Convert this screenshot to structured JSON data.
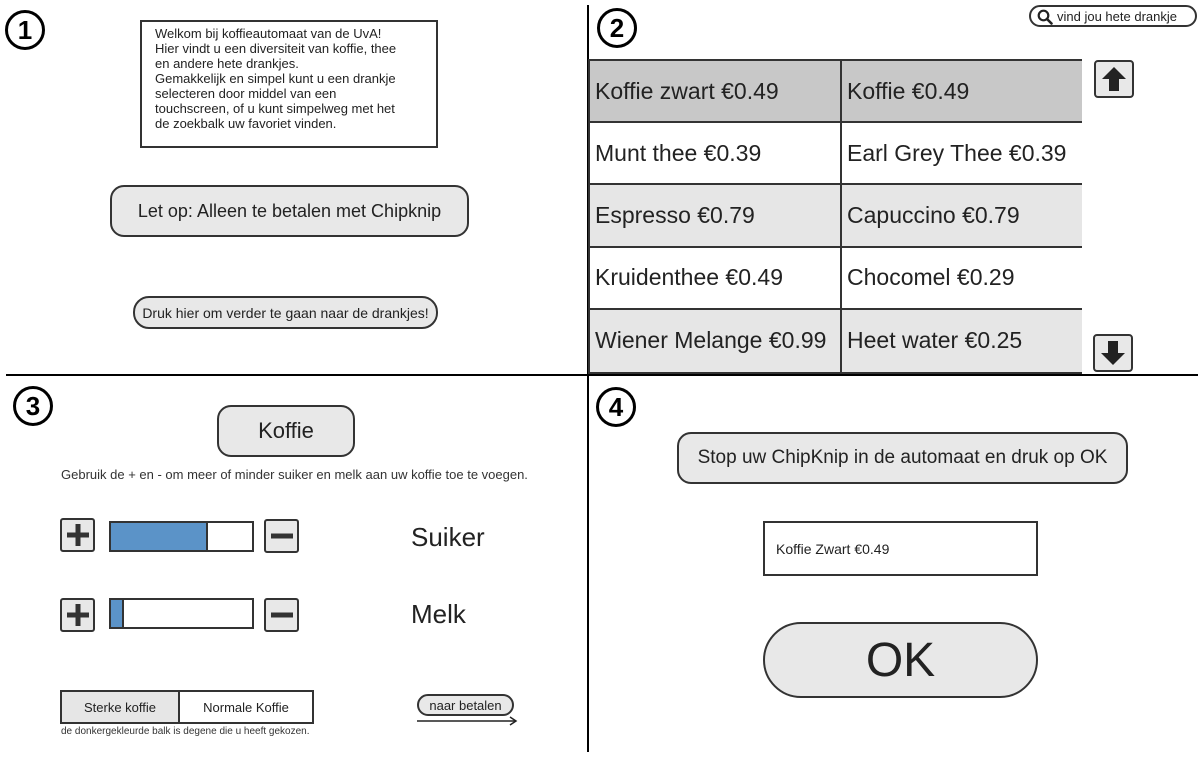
{
  "sections": {
    "s1": {
      "badge": "1",
      "welcome_lines": [
        "Welkom bij koffieautomaat van de UvA!",
        "Hier vindt u een diversiteit van koffie, thee",
        "en andere hete drankjes.",
        "Gemakkelijk en simpel kunt u een drankje",
        "selecteren door middel van een",
        "touchscreen, of u kunt simpelweg met het",
        "de zoekbalk uw favoriet vinden."
      ],
      "notice_label": "Let op: Alleen te betalen met Chipknip",
      "continue_label": "Druk hier om verder te gaan naar de drankjes!"
    },
    "s2": {
      "badge": "2",
      "search_placeholder": "vind jou hete drankje",
      "drinks": [
        {
          "name": "Koffie zwart €0.49",
          "state": "sel"
        },
        {
          "name": "Koffie €0.49",
          "state": "sel"
        },
        {
          "name": "Munt thee €0.39",
          "state": "plain"
        },
        {
          "name": "Earl Grey Thee €0.39",
          "state": "plain"
        },
        {
          "name": "Espresso €0.79",
          "state": "alt"
        },
        {
          "name": "Capuccino €0.79",
          "state": "alt"
        },
        {
          "name": "Kruidenthee €0.49",
          "state": "plain"
        },
        {
          "name": "Chocomel €0.29",
          "state": "plain"
        },
        {
          "name": "Wiener Melange €0.99",
          "state": "alt"
        },
        {
          "name": "Heet water €0.25",
          "state": "alt"
        }
      ]
    },
    "s3": {
      "badge": "3",
      "drink_title": "Koffie",
      "instructions": "Gebruik de + en - om meer of minder suiker en melk aan uw koffie toe te voegen.",
      "sugar_label": "Suiker",
      "sugar_level": 0.69,
      "milk_label": "Melk",
      "milk_level": 0.09,
      "strength_options": [
        "Sterke koffie",
        "Normale Koffie"
      ],
      "strength_note": "de donkergekleurde balk is degene die u heeft gekozen.",
      "pay_label": "naar betalen"
    },
    "s4": {
      "badge": "4",
      "instruction_label": "Stop uw ChipKnip in de automaat en druk op OK",
      "order_text": "Koffie Zwart €0.49",
      "ok_label": "OK"
    }
  },
  "colors": {
    "slider_fill": "#5b93c8",
    "selected_cell": "#c8c8c8",
    "alt_cell": "#e6e6e6",
    "button_fill": "#e8e8e8"
  }
}
